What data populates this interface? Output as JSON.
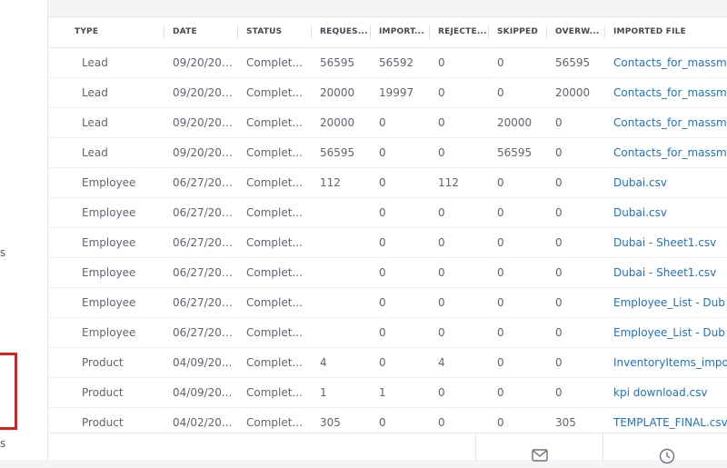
{
  "sidebar": {
    "fragment_top": "s",
    "fragment_bottom": "s"
  },
  "table": {
    "columns": [
      "TYPE",
      "DATE",
      "STATUS",
      "REQUES...",
      "IMPORT...",
      "REJECTE...",
      "SKIPPED",
      "OVERW...",
      "IMPORTED FILE"
    ],
    "rows": [
      {
        "type": "Lead",
        "date": "09/20/201...",
        "status": "Complet...",
        "requested": "56595",
        "imported": "56592",
        "rejected": "0",
        "skipped": "0",
        "overwritten": "56595",
        "file": "Contacts_for_massm"
      },
      {
        "type": "Lead",
        "date": "09/20/201...",
        "status": "Complet...",
        "requested": "20000",
        "imported": "19997",
        "rejected": "0",
        "skipped": "0",
        "overwritten": "20000",
        "file": "Contacts_for_massm"
      },
      {
        "type": "Lead",
        "date": "09/20/201...",
        "status": "Complet...",
        "requested": "20000",
        "imported": "0",
        "rejected": "0",
        "skipped": "20000",
        "overwritten": "0",
        "file": "Contacts_for_massm"
      },
      {
        "type": "Lead",
        "date": "09/20/201...",
        "status": "Complet...",
        "requested": "56595",
        "imported": "0",
        "rejected": "0",
        "skipped": "56595",
        "overwritten": "0",
        "file": "Contacts_for_massm"
      },
      {
        "type": "Employee",
        "date": "06/27/201...",
        "status": "Complet...",
        "requested": "112",
        "imported": "0",
        "rejected": "112",
        "skipped": "0",
        "overwritten": "0",
        "file": "Dubai.csv"
      },
      {
        "type": "Employee",
        "date": "06/27/201...",
        "status": "Complet...",
        "requested": "",
        "imported": "0",
        "rejected": "0",
        "skipped": "0",
        "overwritten": "0",
        "file": "Dubai.csv"
      },
      {
        "type": "Employee",
        "date": "06/27/201...",
        "status": "Complet...",
        "requested": "",
        "imported": "0",
        "rejected": "0",
        "skipped": "0",
        "overwritten": "0",
        "file": "Dubai - Sheet1.csv"
      },
      {
        "type": "Employee",
        "date": "06/27/201...",
        "status": "Complet...",
        "requested": "",
        "imported": "0",
        "rejected": "0",
        "skipped": "0",
        "overwritten": "0",
        "file": "Dubai - Sheet1.csv"
      },
      {
        "type": "Employee",
        "date": "06/27/201...",
        "status": "Complet...",
        "requested": "",
        "imported": "0",
        "rejected": "0",
        "skipped": "0",
        "overwritten": "0",
        "file": "Employee_List - Dub"
      },
      {
        "type": "Employee",
        "date": "06/27/201...",
        "status": "Complet...",
        "requested": "",
        "imported": "0",
        "rejected": "0",
        "skipped": "0",
        "overwritten": "0",
        "file": "Employee_List - Dub"
      },
      {
        "type": "Product",
        "date": "04/09/20...",
        "status": "Complet...",
        "requested": "4",
        "imported": "0",
        "rejected": "4",
        "skipped": "0",
        "overwritten": "0",
        "file": "InventoryItems_impo"
      },
      {
        "type": "Product",
        "date": "04/09/20...",
        "status": "Complet...",
        "requested": "1",
        "imported": "1",
        "rejected": "0",
        "skipped": "0",
        "overwritten": "0",
        "file": "kpi download.csv"
      },
      {
        "type": "Product",
        "date": "04/02/20...",
        "status": "Complet...",
        "requested": "305",
        "imported": "0",
        "rejected": "0",
        "skipped": "0",
        "overwritten": "305",
        "file": "TEMPLATE_FINAL.csv"
      }
    ]
  },
  "footer": {
    "buttons": [
      {
        "icon": "mail-icon"
      },
      {
        "icon": "clock-icon"
      }
    ]
  },
  "colors": {
    "link": "#1d73c9",
    "text": "#5f6570",
    "header_text": "#444a52",
    "highlight": "#e01d1d"
  }
}
